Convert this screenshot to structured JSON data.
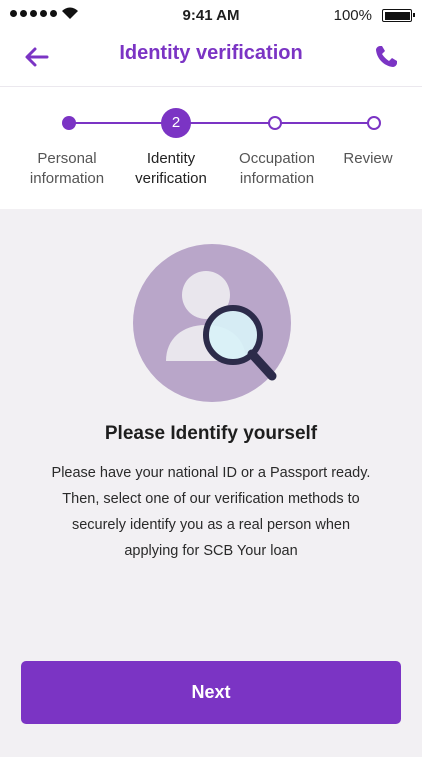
{
  "status_bar": {
    "time": "9:41 AM",
    "battery": "100%"
  },
  "nav": {
    "title": "Identity verification",
    "back_icon": "arrow-left-icon",
    "call_icon": "phone-icon"
  },
  "steps": [
    {
      "label_line1": "Personal",
      "label_line2": "information",
      "state": "done"
    },
    {
      "label_line1": "Identity",
      "label_line2": "verification",
      "state": "current",
      "number": "2"
    },
    {
      "label_line1": "Occupation",
      "label_line2": "information",
      "state": "todo"
    },
    {
      "label_line1": "Review",
      "label_line2": "",
      "state": "todo"
    }
  ],
  "content": {
    "illustration_icon": "person-magnifier-icon",
    "heading": "Please Identify yourself",
    "description_lines": [
      "Please have your national ID or a Passport ready.",
      "Then, select one of our verification methods to",
      "securely identify you as a real person when",
      "applying for SCB Your loan"
    ]
  },
  "footer": {
    "next_label": "Next"
  },
  "colors": {
    "accent": "#7b34c4",
    "background": "#f2f0f3",
    "illustration_bg": "#b9a6c9"
  }
}
